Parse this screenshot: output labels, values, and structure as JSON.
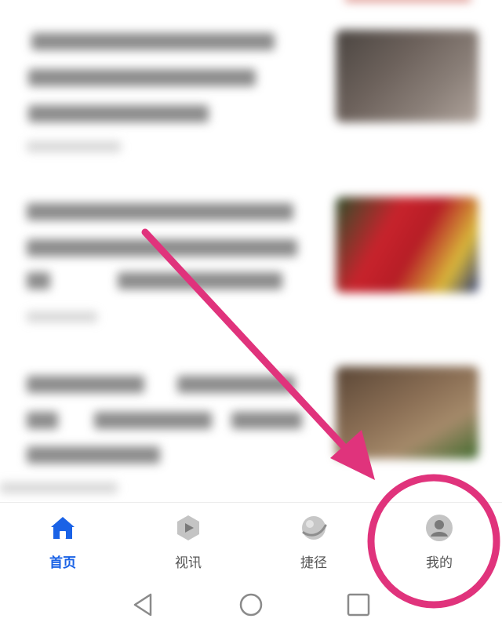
{
  "bottom_nav": {
    "items": [
      {
        "label": "首页",
        "icon": "home-icon",
        "active": true
      },
      {
        "label": "视讯",
        "icon": "video-play-icon",
        "active": false
      },
      {
        "label": "捷径",
        "icon": "shortcut-planet-icon",
        "active": false
      },
      {
        "label": "我的",
        "icon": "profile-avatar-icon",
        "active": false
      }
    ]
  },
  "system_nav": {
    "buttons": [
      "back-triangle-icon",
      "home-circle-icon",
      "recents-square-icon"
    ]
  },
  "colors": {
    "accent": "#1a62e6",
    "annotation": "#e0337c",
    "inactive_icon": "#bdbdbd",
    "inactive_label": "#555555"
  }
}
